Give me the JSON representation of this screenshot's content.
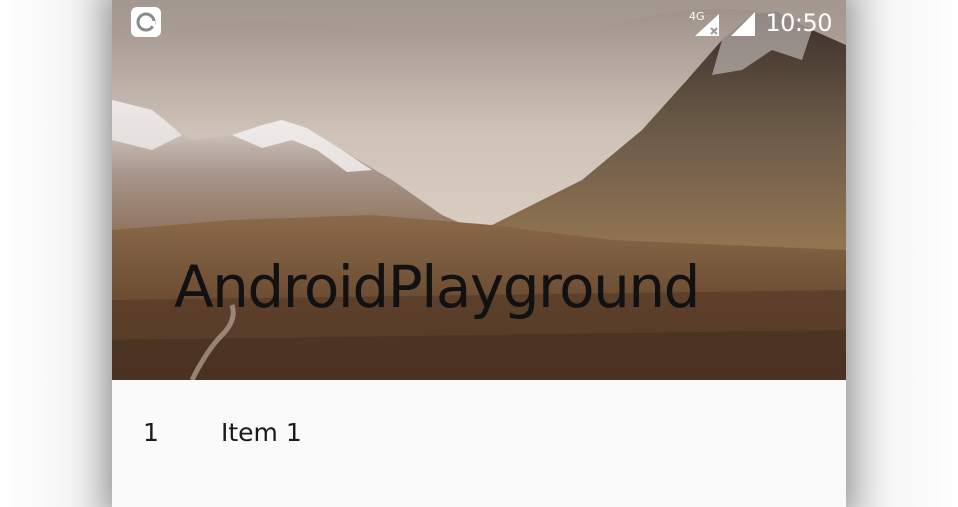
{
  "status_bar": {
    "notification_icon": "loop-notification-icon",
    "network_label": "4G",
    "time": "10:50"
  },
  "header": {
    "title": "AndroidPlayground",
    "image": "mountain-valley-landscape"
  },
  "list": {
    "items": [
      {
        "number": "1",
        "label": "Item 1"
      }
    ]
  },
  "colors": {
    "list_background": "#fafafa",
    "title_text": "#111111",
    "status_text": "#ffffff"
  }
}
